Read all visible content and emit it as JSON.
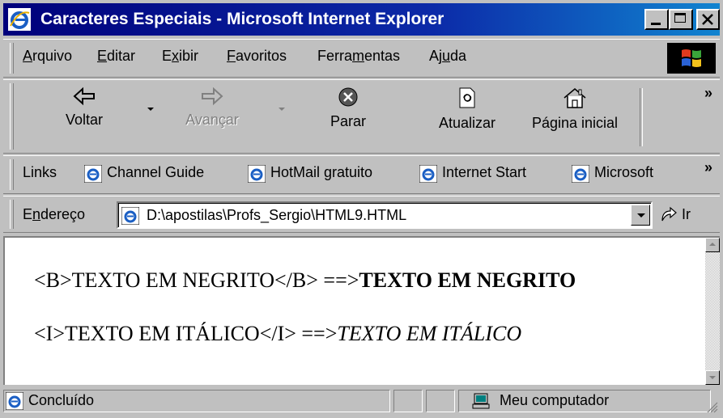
{
  "window": {
    "title": "Caracteres Especiais - Microsoft Internet Explorer"
  },
  "menu": {
    "items": [
      {
        "prefix": "",
        "accel": "A",
        "rest": "rquivo"
      },
      {
        "prefix": "",
        "accel": "E",
        "rest": "ditar"
      },
      {
        "prefix": "E",
        "accel": "x",
        "rest": "ibir"
      },
      {
        "prefix": "",
        "accel": "F",
        "rest": "avoritos"
      },
      {
        "prefix": "Ferra",
        "accel": "m",
        "rest": "entas"
      },
      {
        "prefix": "Aj",
        "accel": "u",
        "rest": "da"
      }
    ]
  },
  "toolbar": {
    "back": "Voltar",
    "forward": "Avançar",
    "stop": "Parar",
    "refresh": "Atualizar",
    "home": "Página inicial",
    "more": "»"
  },
  "links_bar": {
    "label": "Links",
    "items": [
      "Channel Guide",
      "HotMail gratuito",
      "Internet Start",
      "Microsoft"
    ],
    "more": "»"
  },
  "address_bar": {
    "label_prefix": "E",
    "label_accel": "n",
    "label_rest": "dereço",
    "value": "D:\\apostilas\\Profs_Sergio\\HTML9.HTML",
    "go": "Ir"
  },
  "content": {
    "line1_code": "<B>TEXTO EM NEGRITO</B> ==>",
    "line1_result": "TEXTO EM NEGRITO",
    "line2_code": "<I>TEXTO EM ITÁLICO</I> ==>",
    "line2_result": "TEXTO EM ITÁLICO"
  },
  "status": {
    "text": "Concluído",
    "zone": "Meu computador"
  },
  "colors": {
    "titlebar": "#00007b",
    "chrome": "#c0c0c0"
  }
}
